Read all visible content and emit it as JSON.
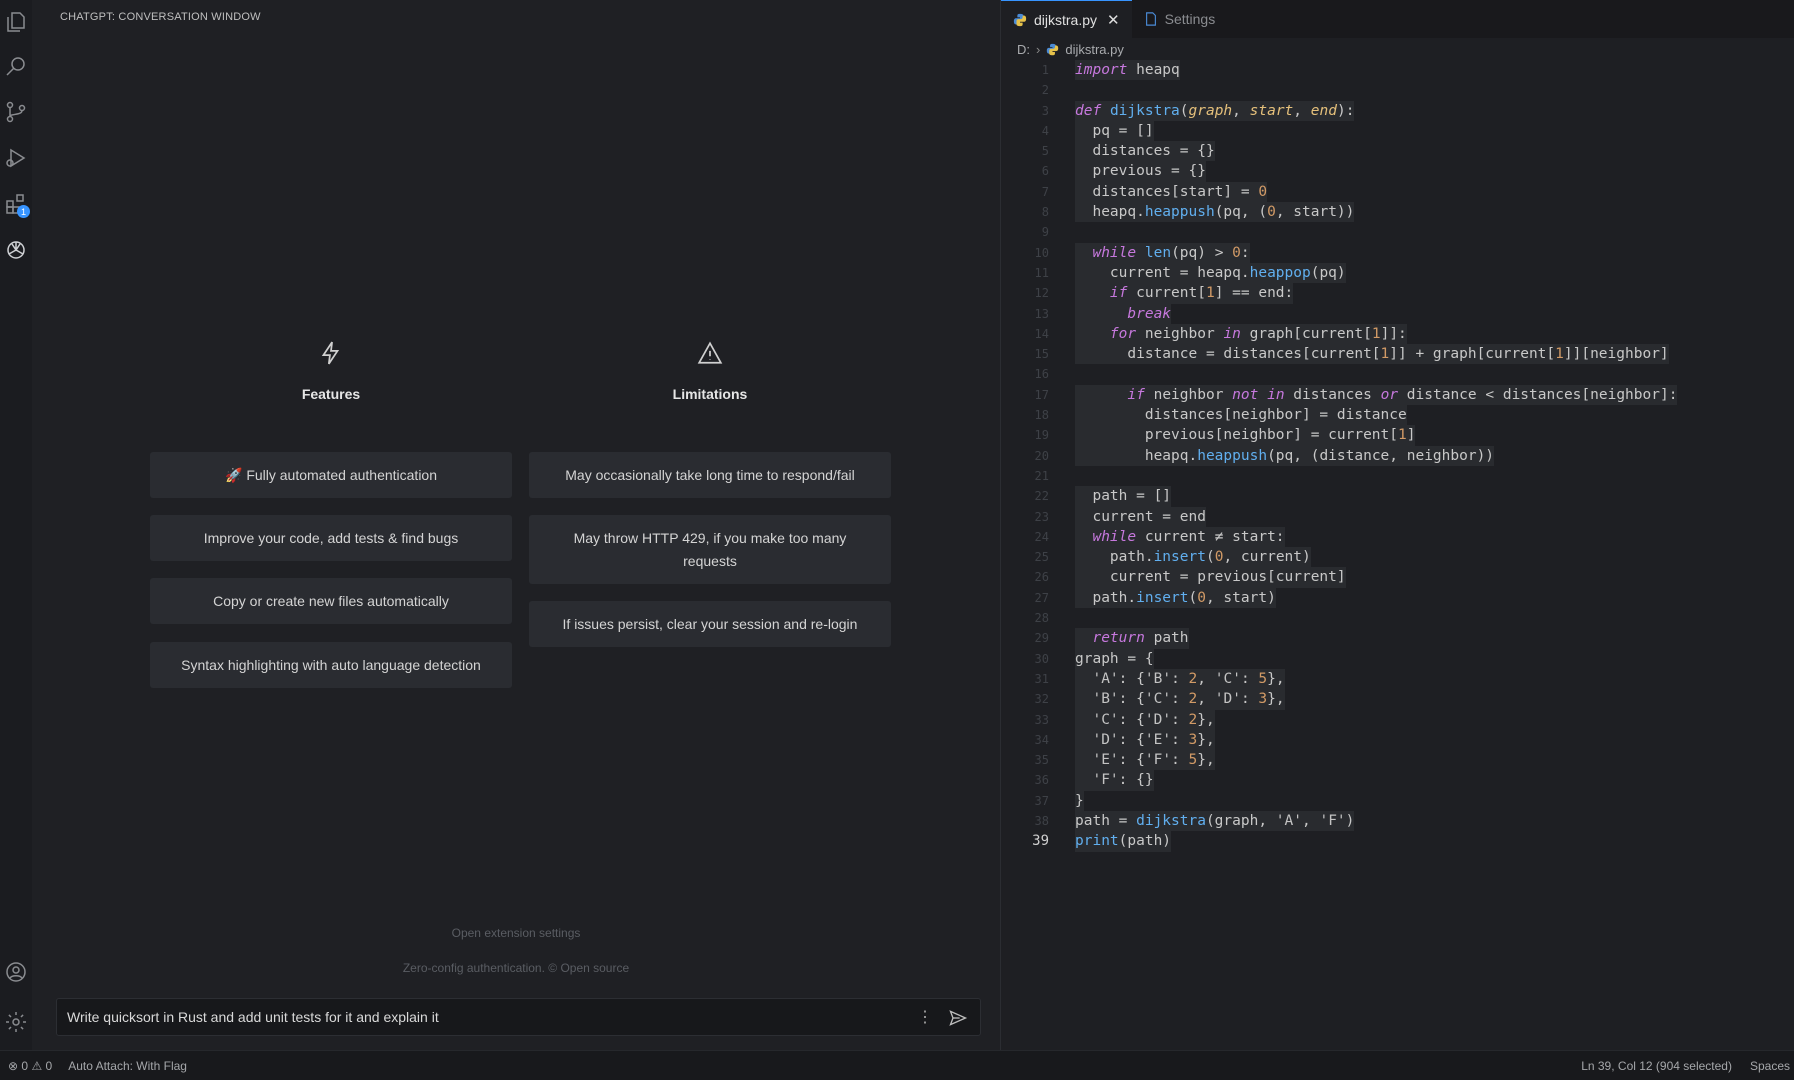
{
  "chat": {
    "title": "CHATGPT: CONVERSATION WINDOW",
    "features": {
      "heading": "Features",
      "items": [
        "🚀 Fully automated authentication",
        "Improve your code, add tests & find bugs",
        "Copy or create new files automatically",
        "Syntax highlighting with auto language detection"
      ]
    },
    "limitations": {
      "heading": "Limitations",
      "items": [
        "May occasionally take long time to respond/fail",
        "May throw HTTP 429, if you make too many requests",
        "If issues persist, clear your session and re-login"
      ]
    },
    "footer_link": "Open extension settings",
    "footer_note": "Zero-config authentication. © Open source",
    "input_value": "Write quicksort in Rust and add unit tests for it and explain it",
    "more_label": "⋮"
  },
  "activity": {
    "extensions_badge": "1"
  },
  "editor": {
    "tabs": [
      {
        "label": "dijkstra.py",
        "close": "✕"
      },
      {
        "label": "Settings"
      }
    ],
    "breadcrumb": {
      "drive": "D:",
      "sep": "›",
      "file": "dijkstra.py"
    },
    "current_line": 39,
    "lines": [
      "import heapq",
      "",
      "def dijkstra(graph, start, end):",
      "  pq = []",
      "  distances = {}",
      "  previous = {}",
      "  distances[start] = 0",
      "  heapq.heappush(pq, (0, start))",
      "",
      "  while len(pq) > 0:",
      "    current = heapq.heappop(pq)",
      "    if current[1] == end:",
      "      break",
      "    for neighbor in graph[current[1]]:",
      "      distance = distances[current[1]] + graph[current[1]][neighbor]",
      "",
      "      if neighbor not in distances or distance < distances[neighbor]:",
      "        distances[neighbor] = distance",
      "        previous[neighbor] = current[1]",
      "        heapq.heappush(pq, (distance, neighbor))",
      "",
      "  path = []",
      "  current = end",
      "  while current ≠ start:",
      "    path.insert(0, current)",
      "    current = previous[current]",
      "  path.insert(0, start)",
      "",
      "  return path",
      "graph = {",
      "  'A': {'B': 2, 'C': 5},",
      "  'B': {'C': 2, 'D': 3},",
      "  'C': {'D': 2},",
      "  'D': {'E': 3},",
      "  'E': {'F': 5},",
      "  'F': {}",
      "}",
      "path = dijkstra(graph, 'A', 'F')",
      "print(path)"
    ]
  },
  "status": {
    "errors": "0",
    "warnings": "0",
    "auto_attach": "Auto Attach: With Flag",
    "position": "Ln 39, Col 12 (904 selected)",
    "spaces": "Spaces"
  }
}
